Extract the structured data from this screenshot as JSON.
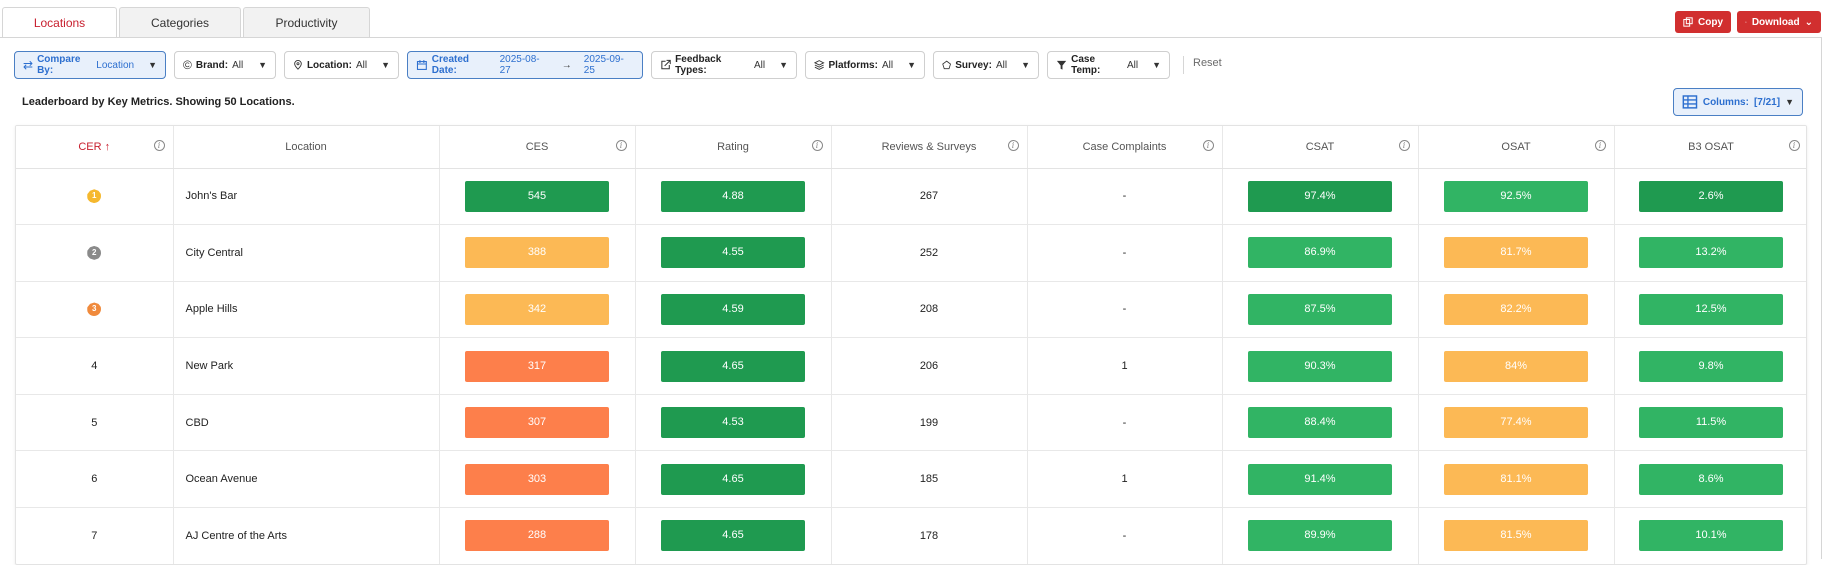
{
  "tabs": [
    {
      "label": "Locations",
      "active": true
    },
    {
      "label": "Categories",
      "active": false
    },
    {
      "label": "Productivity",
      "active": false
    }
  ],
  "actions": {
    "copy": "Copy",
    "download": "Download"
  },
  "filters": {
    "compare_by": {
      "label": "Compare By:",
      "value": "Location"
    },
    "brand": {
      "label": "Brand:",
      "value": "All"
    },
    "location": {
      "label": "Location:",
      "value": "All"
    },
    "created_date": {
      "label": "Created Date:",
      "from": "2025-08-27",
      "arrow": "→",
      "to": "2025-09-25"
    },
    "feedback_types": {
      "label": "Feedback Types:",
      "value": "All"
    },
    "platforms": {
      "label": "Platforms:",
      "value": "All"
    },
    "survey": {
      "label": "Survey:",
      "value": "All"
    },
    "case_temp": {
      "label": "Case Temp:",
      "value": "All"
    },
    "reset": "Reset"
  },
  "subtitle": "Leaderboard by Key Metrics. Showing 50 Locations.",
  "columns_btn": {
    "label": "Columns:",
    "value": "[7/21]"
  },
  "table": {
    "headers": [
      "CER",
      "Location",
      "CES",
      "Rating",
      "Reviews & Surveys",
      "Case Complaints",
      "CSAT",
      "OSAT",
      "B3 OSAT"
    ],
    "rows": [
      {
        "rank": "1",
        "location": "John's Bar",
        "ces": "545",
        "rating": "4.88",
        "reviews": "267",
        "cases": "-",
        "csat": "97.4%",
        "osat": "92.5%",
        "b3": "2.6%"
      },
      {
        "rank": "2",
        "location": "City Central",
        "ces": "388",
        "rating": "4.55",
        "reviews": "252",
        "cases": "-",
        "csat": "86.9%",
        "osat": "81.7%",
        "b3": "13.2%"
      },
      {
        "rank": "3",
        "location": "Apple Hills",
        "ces": "342",
        "rating": "4.59",
        "reviews": "208",
        "cases": "-",
        "csat": "87.5%",
        "osat": "82.2%",
        "b3": "12.5%"
      },
      {
        "rank": "4",
        "location": "New Park",
        "ces": "317",
        "rating": "4.65",
        "reviews": "206",
        "cases": "1",
        "csat": "90.3%",
        "osat": "84%",
        "b3": "9.8%"
      },
      {
        "rank": "5",
        "location": "CBD",
        "ces": "307",
        "rating": "4.53",
        "reviews": "199",
        "cases": "-",
        "csat": "88.4%",
        "osat": "77.4%",
        "b3": "11.5%"
      },
      {
        "rank": "6",
        "location": "Ocean Avenue",
        "ces": "303",
        "rating": "4.65",
        "reviews": "185",
        "cases": "1",
        "csat": "91.4%",
        "osat": "81.1%",
        "b3": "8.6%"
      },
      {
        "rank": "7",
        "location": "AJ Centre of the Arts",
        "ces": "288",
        "rating": "4.65",
        "reviews": "178",
        "cases": "-",
        "csat": "89.9%",
        "osat": "81.5%",
        "b3": "10.1%"
      }
    ]
  },
  "colors": {
    "dark_green": "#1f9a50",
    "green": "#31b464",
    "amber": "#fcb955",
    "orange": "#fd7f4b",
    "brand_red": "#d12f2f",
    "accent_blue": "#2d6fcf",
    "gold": "#f5b82e",
    "silver": "#8a8a8a",
    "bronze": "#f08a3c"
  }
}
